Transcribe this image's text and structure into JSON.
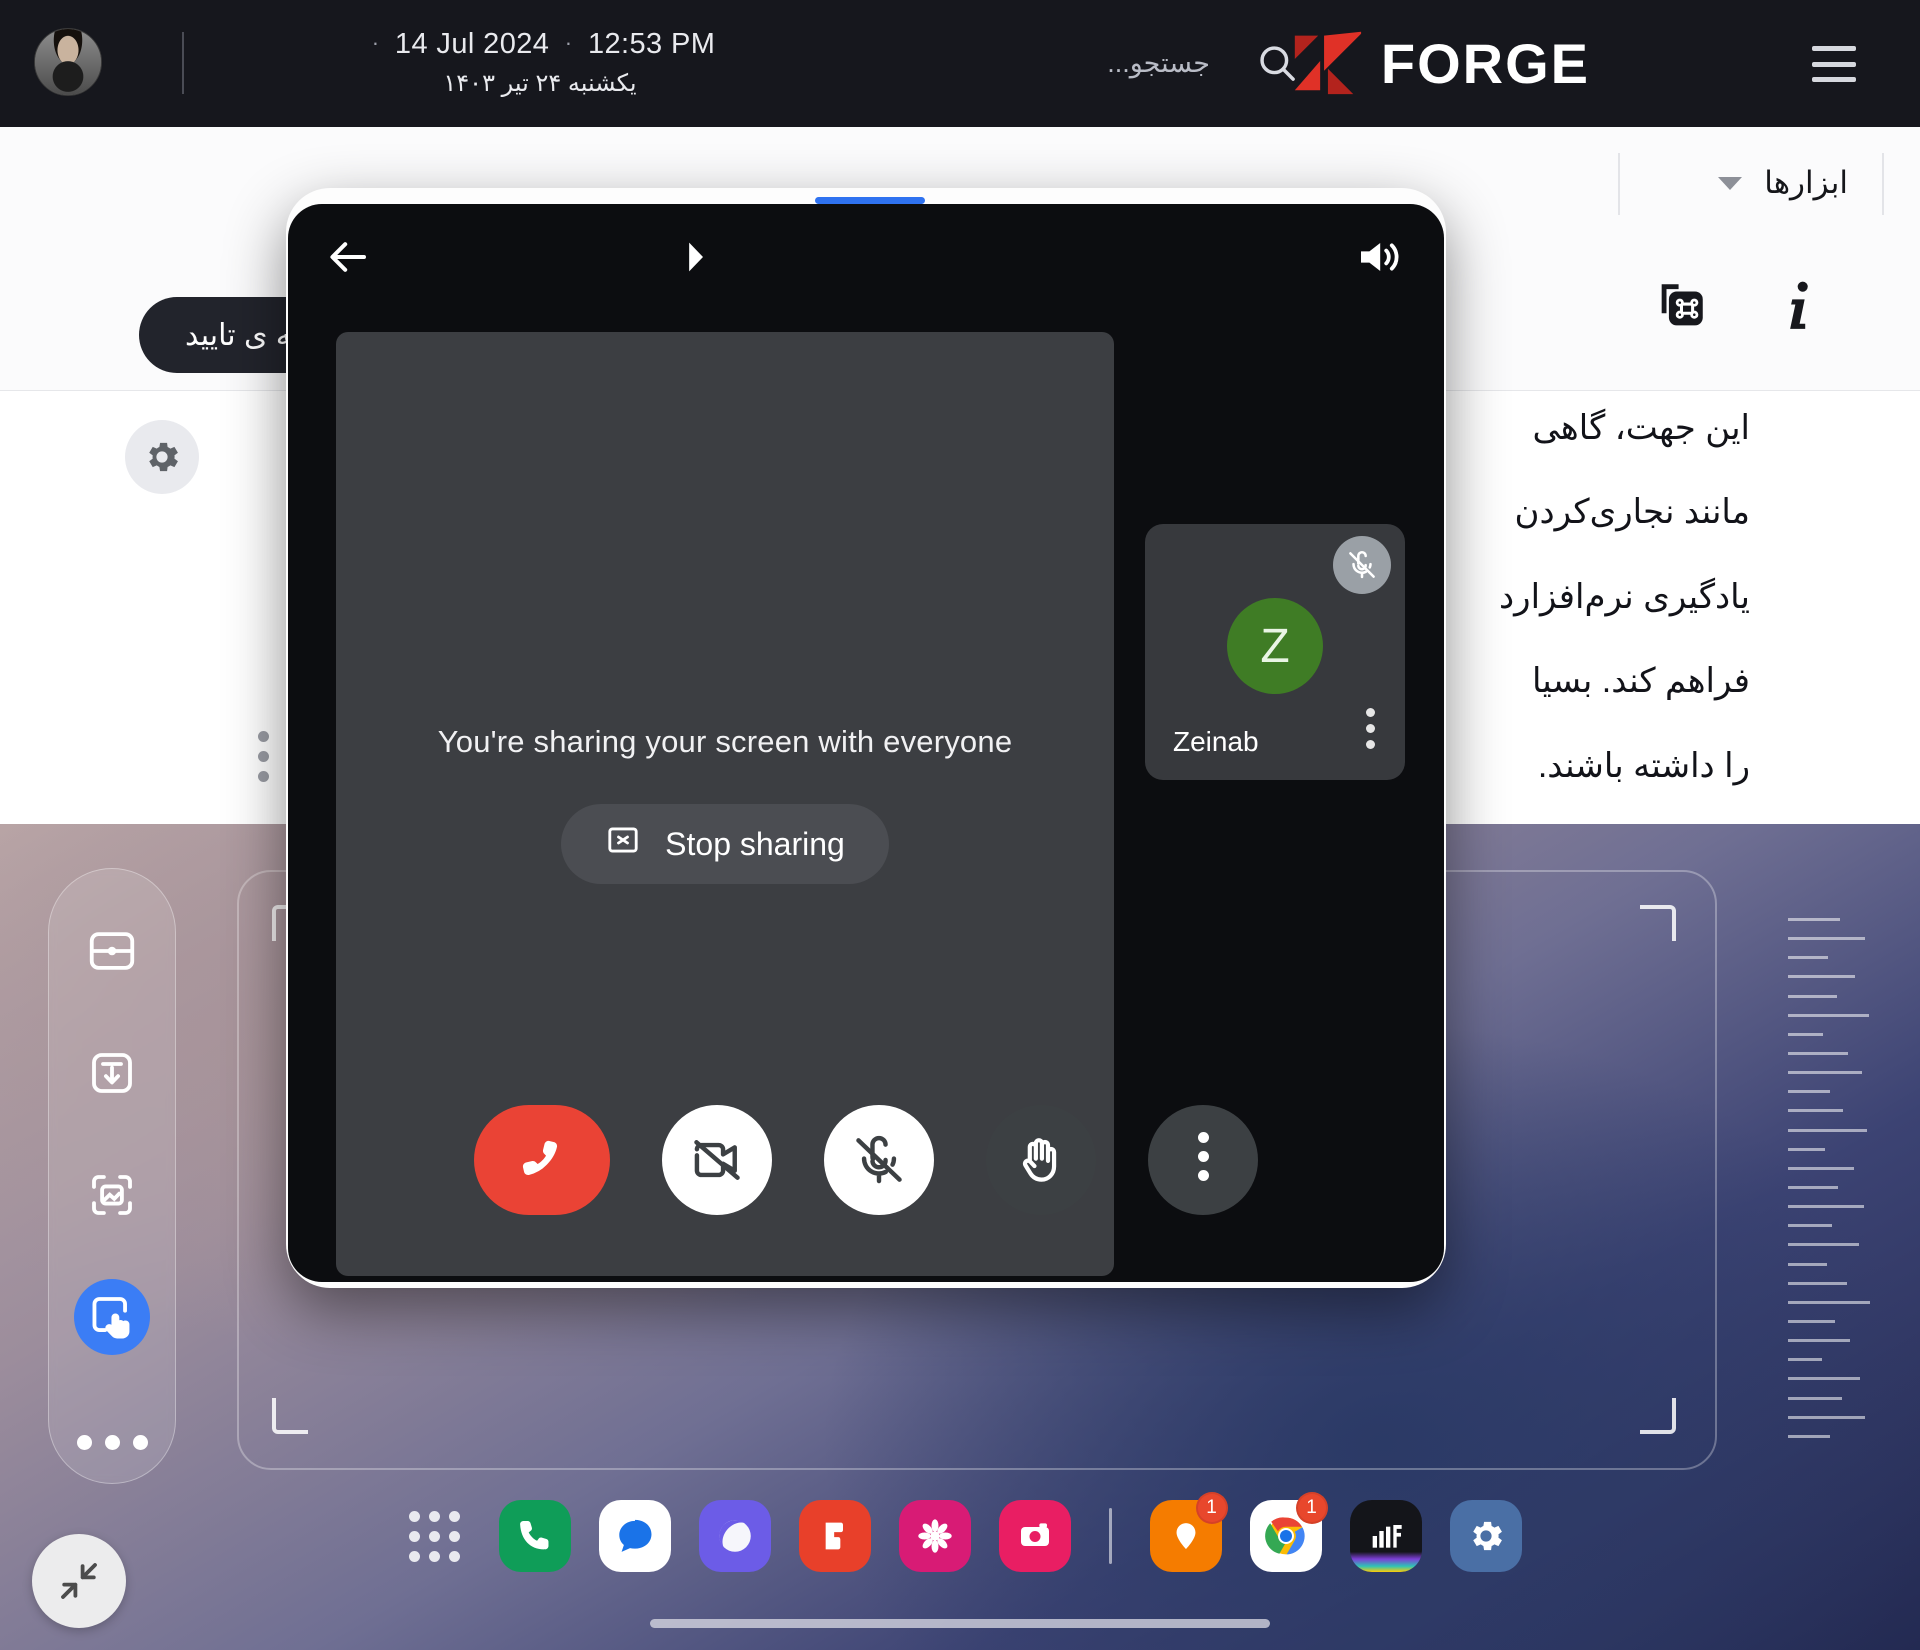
{
  "header": {
    "date_en": "14 Jul 2024",
    "time": "12:53 PM",
    "date_fa": "یکشنبه ۲۴ تیر ۱۴۰۳",
    "sep_dot": "·",
    "search_placeholder": "جستجو...",
    "brand": "FORGE",
    "search_icon": "search-icon",
    "menu_icon": "hamburger-menu-icon",
    "avatar": "user-avatar"
  },
  "page": {
    "tools_label": "ابزارها",
    "approved_pill": "خه ی تایید",
    "command_icon": "command-shortcut-icon",
    "info_icon": "info-icon",
    "gear_icon": "settings-gear-icon",
    "paragraphs": [
      "این جهت، گاهی",
      "مانند نجاری‌کردن",
      "یادگیری نرم‌افزارد",
      "فراهم کند. بسیا",
      "را داشته باشند."
    ]
  },
  "call": {
    "back_icon": "back-arrow-icon",
    "play_icon": "play-arrow-icon",
    "speaker_icon": "speaker-volume-icon",
    "share_message": "You're sharing your screen with everyone",
    "stop_sharing_label": "Stop sharing",
    "stop_sharing_icon": "stop-screenshare-icon",
    "participant": {
      "name": "Zeinab",
      "initial": "Z",
      "avatar_color": "#3f7c25",
      "mic_muted_icon": "mic-off-icon",
      "more_icon": "more-vertical-icon"
    },
    "controls": [
      {
        "name": "end-call-button",
        "icon": "phone-hangup-icon",
        "style": "end",
        "color": "#ea4335"
      },
      {
        "name": "camera-toggle-button",
        "icon": "video-off-icon",
        "style": "light"
      },
      {
        "name": "mic-toggle-button",
        "icon": "mic-off-icon",
        "style": "light"
      },
      {
        "name": "raise-hand-button",
        "icon": "raise-hand-icon",
        "style": "dark"
      },
      {
        "name": "more-options-button",
        "icon": "more-vertical-icon",
        "style": "dark"
      }
    ]
  },
  "edge_panel": {
    "items": [
      {
        "name": "split-screen-icon",
        "active": false
      },
      {
        "name": "pull-down-window-icon",
        "active": false
      },
      {
        "name": "screenshot-capture-icon",
        "active": false
      },
      {
        "name": "touch-pointer-icon",
        "active": true
      },
      {
        "name": "more-dots-icon",
        "active": false
      }
    ],
    "accent_color": "#3b7df5"
  },
  "collapse_button": {
    "icon": "collapse-arrows-icon"
  },
  "dock": {
    "app_drawer_icon": "app-grid-icon",
    "apps": [
      {
        "name": "phone-app",
        "color": "#0f9d58",
        "badge": ""
      },
      {
        "name": "messages-app",
        "color": "#ffffff",
        "badge": ""
      },
      {
        "name": "samsung-internet-app",
        "color": "#6c5ce7",
        "badge": ""
      },
      {
        "name": "store-app",
        "color": "#e8402a",
        "badge": ""
      },
      {
        "name": "photos-app",
        "color": "#d81b75",
        "badge": ""
      },
      {
        "name": "camera-app",
        "color": "#e91e63",
        "badge": ""
      },
      {
        "name": "maps-app",
        "color": "#f57c00",
        "badge": "1"
      },
      {
        "name": "chrome-app",
        "color": "#ffffff",
        "badge": "1"
      },
      {
        "name": "finance-app",
        "color": "#101014",
        "badge": ""
      },
      {
        "name": "settings-app",
        "color": "#4a6fa5",
        "badge": ""
      }
    ]
  }
}
